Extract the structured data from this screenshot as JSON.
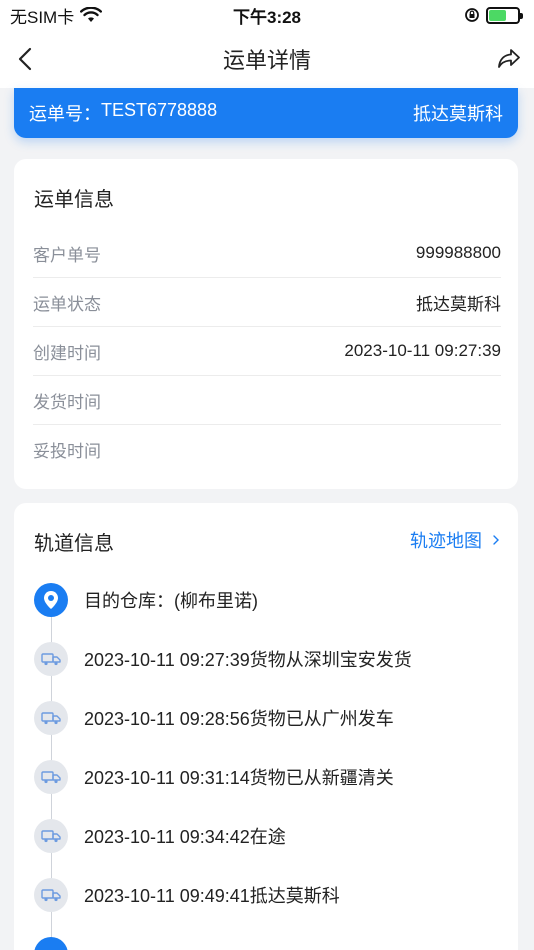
{
  "status_bar": {
    "carrier": "无SIM卡",
    "time": "下午3:28"
  },
  "nav": {
    "title": "运单详情"
  },
  "waybill": {
    "label": "运单号：",
    "number": "TEST6778888",
    "status": "抵达莫斯科"
  },
  "info_card": {
    "title": "运单信息",
    "rows": [
      {
        "label": "客户单号",
        "value": "999988800"
      },
      {
        "label": "运单状态",
        "value": "抵达莫斯科"
      },
      {
        "label": "创建时间",
        "value": "2023-10-11 09:27:39"
      },
      {
        "label": "发货时间",
        "value": ""
      },
      {
        "label": "妥投时间",
        "value": ""
      }
    ]
  },
  "track_card": {
    "title": "轨道信息",
    "map_link": "轨迹地图",
    "events": [
      {
        "text": "目的仓库：(柳布里诺)",
        "icon": "location-pin-icon",
        "active": true
      },
      {
        "text": "2023-10-11 09:27:39货物从深圳宝安发货",
        "icon": "truck-icon",
        "active": false
      },
      {
        "text": "2023-10-11 09:28:56货物已从广州发车",
        "icon": "truck-icon",
        "active": false
      },
      {
        "text": "2023-10-11 09:31:14货物已从新疆清关",
        "icon": "truck-icon",
        "active": false
      },
      {
        "text": "2023-10-11 09:34:42在途",
        "icon": "truck-icon",
        "active": false
      },
      {
        "text": "2023-10-11 09:49:41抵达莫斯科",
        "icon": "truck-icon",
        "active": false
      }
    ]
  },
  "colors": {
    "accent": "#1a7df2",
    "background": "#f2f3f5",
    "label_gray": "#8a8f99"
  }
}
